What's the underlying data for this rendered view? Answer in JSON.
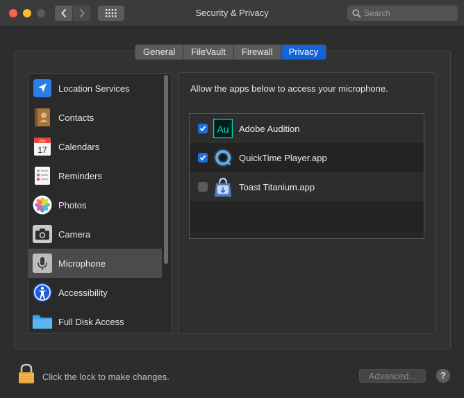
{
  "window": {
    "title": "Security & Privacy",
    "search_placeholder": "Search"
  },
  "tabs": [
    {
      "label": "General",
      "active": false
    },
    {
      "label": "FileVault",
      "active": false
    },
    {
      "label": "Firewall",
      "active": false
    },
    {
      "label": "Privacy",
      "active": true
    }
  ],
  "sidebar": {
    "items": [
      {
        "label": "Location Services",
        "icon": "location-arrow-icon"
      },
      {
        "label": "Contacts",
        "icon": "contacts-book-icon"
      },
      {
        "label": "Calendars",
        "icon": "calendar-icon",
        "icon_text_month": "JUL",
        "icon_text_day": "17"
      },
      {
        "label": "Reminders",
        "icon": "reminders-list-icon"
      },
      {
        "label": "Photos",
        "icon": "photos-flower-icon"
      },
      {
        "label": "Camera",
        "icon": "camera-icon"
      },
      {
        "label": "Microphone",
        "icon": "microphone-icon",
        "selected": true
      },
      {
        "label": "Accessibility",
        "icon": "accessibility-person-icon"
      },
      {
        "label": "Full Disk Access",
        "icon": "folder-icon"
      }
    ]
  },
  "main": {
    "description": "Allow the apps below to access your microphone.",
    "apps": [
      {
        "name": "Adobe Audition",
        "checked": true,
        "icon": "adobe-audition-icon",
        "icon_text": "Au"
      },
      {
        "name": "QuickTime Player.app",
        "checked": true,
        "icon": "quicktime-icon"
      },
      {
        "name": "Toast Titanium.app",
        "checked": false,
        "icon": "toast-titanium-icon"
      }
    ]
  },
  "footer": {
    "lock_text": "Click the lock to make changes.",
    "advanced_label": "Advanced...",
    "help_label": "?"
  },
  "colors": {
    "accent": "#1464d9",
    "checkbox_on": "#1e6fe0",
    "close": "#fe5f57",
    "minimize": "#febc2e",
    "lock": "#e9a93a",
    "audition": "#00e4bb"
  }
}
